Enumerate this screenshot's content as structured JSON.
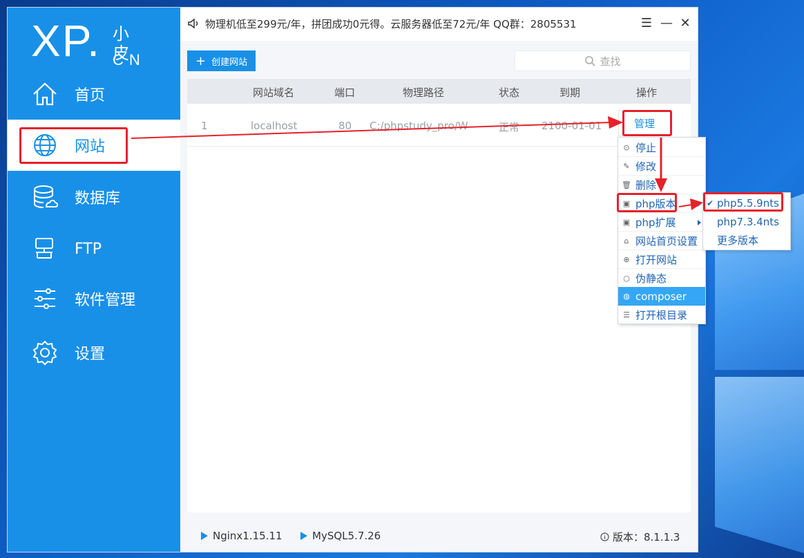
{
  "app": {
    "logo": {
      "xp": "XP.",
      "cn_top": "小皮",
      "cn_bottom": "CN"
    },
    "notice": "物理机低至299元/年，拼团成功0元得。云服务器低至72元/年  QQ群：2805531",
    "window_controls": {
      "menu": "☰",
      "minimize": "—",
      "close": "✕"
    }
  },
  "sidebar": {
    "items": [
      {
        "label": "首页",
        "icon": "home-icon"
      },
      {
        "label": "网站",
        "icon": "globe-icon",
        "active": true
      },
      {
        "label": "数据库",
        "icon": "database-icon"
      },
      {
        "label": "FTP",
        "icon": "ftp-icon"
      },
      {
        "label": "软件管理",
        "icon": "sliders-icon"
      },
      {
        "label": "设置",
        "icon": "gear-icon"
      }
    ]
  },
  "toolbar": {
    "create_label": "创建网站",
    "search_placeholder": "查找"
  },
  "table": {
    "columns": [
      "网站域名",
      "端口",
      "物理路径",
      "状态",
      "到期",
      "操作"
    ],
    "rows": [
      {
        "index": "1",
        "domain": "localhost",
        "port": "80",
        "path": "C:/phpstudy_pro/W",
        "status": "正常",
        "expiry": "2100-01-01",
        "action": "管理"
      }
    ]
  },
  "context_menu": {
    "items": [
      {
        "label": "停止",
        "icon": "stop-icon"
      },
      {
        "label": "修改",
        "icon": "pencil-icon"
      },
      {
        "label": "删除",
        "icon": "trash-icon"
      },
      {
        "label": "php版本",
        "icon": "php-version-icon",
        "submenu": true
      },
      {
        "label": "php扩展",
        "icon": "php-extension-icon",
        "submenu": true
      },
      {
        "label": "网站首页设置",
        "icon": "house-icon"
      },
      {
        "label": "打开网站",
        "icon": "globe-small-icon"
      },
      {
        "label": "伪静态",
        "icon": "circle-icon"
      },
      {
        "label": "composer",
        "icon": "composer-icon",
        "selected": true
      },
      {
        "label": "打开根目录",
        "icon": "list-icon"
      }
    ]
  },
  "php_submenu": {
    "items": [
      {
        "label": "php5.5.9nts",
        "checked": true
      },
      {
        "label": "php7.3.4nts"
      },
      {
        "label": "更多版本"
      }
    ]
  },
  "footer": {
    "nginx": "Nginx1.15.11",
    "mysql": "MySQL5.7.26",
    "version": "版本：8.1.1.3"
  },
  "colors": {
    "sidebar_blue": "#1890e8",
    "highlight_red": "#e5212a",
    "menu_selected": "#35a6f5"
  }
}
